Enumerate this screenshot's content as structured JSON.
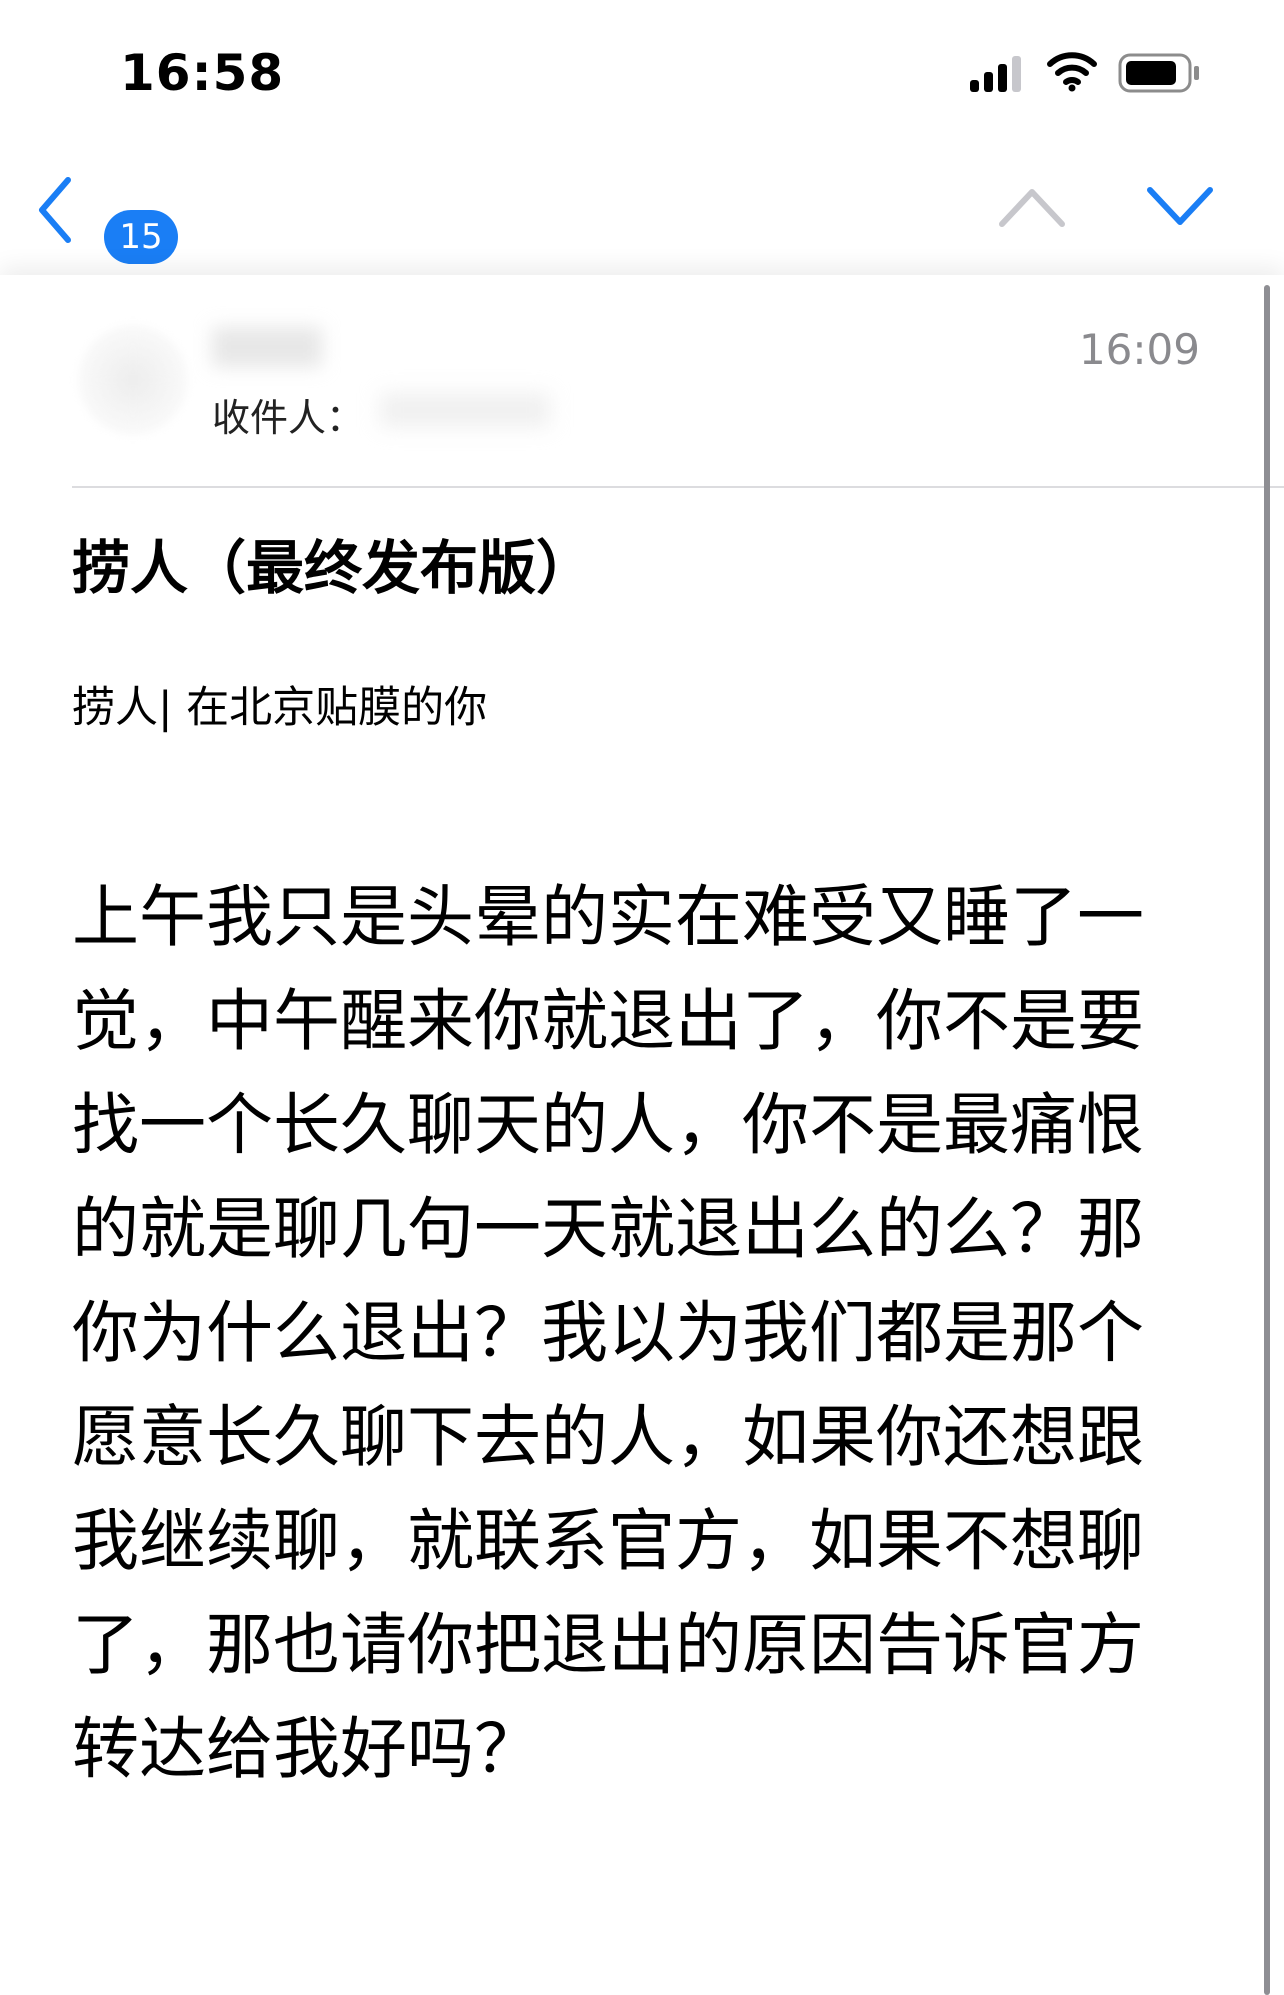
{
  "status_bar": {
    "time": "16:58",
    "signal_icon": "cellular-signal-icon",
    "wifi_icon": "wifi-icon",
    "battery_icon": "battery-icon"
  },
  "nav": {
    "back_icon": "chevron-left-icon",
    "unread_count": "15",
    "prev_icon": "chevron-up-icon",
    "next_icon": "chevron-down-icon",
    "accent_color": "#1a7ef5",
    "disabled_color": "#c7c7cc"
  },
  "message": {
    "recipient_label": "收件人：",
    "time": "16:09",
    "subject": "捞人（最终发布版）",
    "preheader": "捞人|  在北京贴膜的你",
    "body": "上午我只是头晕的实在难受又睡了一觉，中午醒来你就退出了，你不是要找一个长久聊天的人，你不是最痛恨的就是聊几句一天就退出么的么？那你为什么退出？我以为我们都是那个愿意长久聊下去的人，如果你还想跟我继续聊，就联系官方，如果不想聊了，那也请你把退出的原因告诉官方转达给我好吗？"
  }
}
